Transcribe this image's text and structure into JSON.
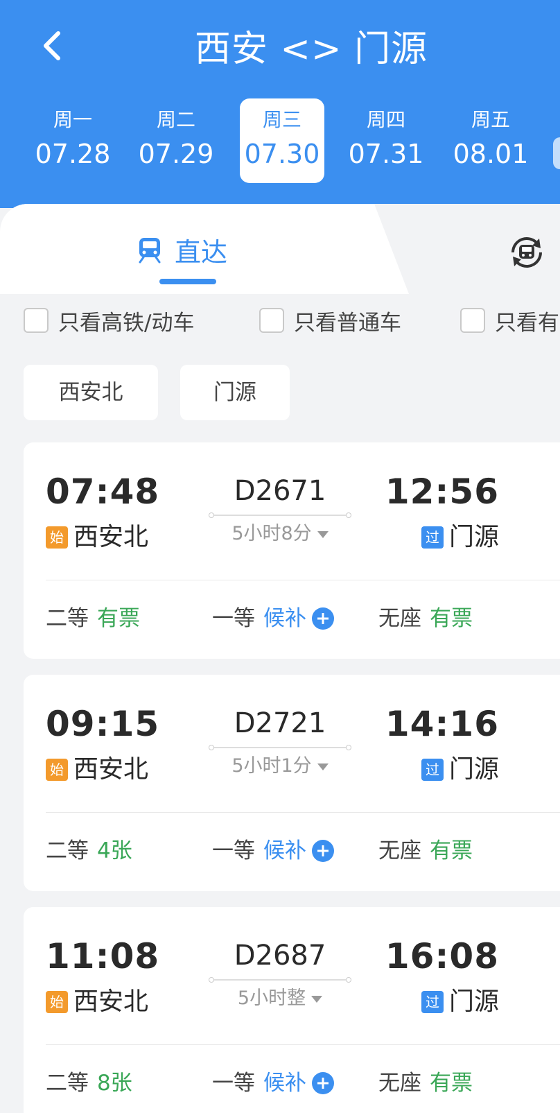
{
  "header": {
    "title": "西安 <> 门源",
    "dates": [
      {
        "weekday": "周一",
        "date": "07.28"
      },
      {
        "weekday": "周二",
        "date": "07.29"
      },
      {
        "weekday": "周三",
        "date": "07.30",
        "selected": true
      },
      {
        "weekday": "周四",
        "date": "07.31"
      },
      {
        "weekday": "周五",
        "date": "08.01"
      }
    ]
  },
  "tabs": {
    "direct_label": "直达",
    "transfer_icon": "transfer-train-icon"
  },
  "filters": [
    {
      "label": "只看高铁/动车",
      "checked": false
    },
    {
      "label": "只看普通车",
      "checked": false
    },
    {
      "label": "只看有",
      "checked": false
    }
  ],
  "stations": [
    "西安北",
    "门源"
  ],
  "trains": [
    {
      "dep_time": "07:48",
      "train_no": "D2671",
      "arr_time": "12:56",
      "dep_tag": "始",
      "dep_station": "西安北",
      "duration": "5小时8分",
      "arr_tag": "过",
      "arr_station": "门源",
      "seats": [
        {
          "name": "二等",
          "status": "有票"
        },
        {
          "name": "一等",
          "status": "候补"
        },
        {
          "name": "无座",
          "status": "有票"
        }
      ]
    },
    {
      "dep_time": "09:15",
      "train_no": "D2721",
      "arr_time": "14:16",
      "dep_tag": "始",
      "dep_station": "西安北",
      "duration": "5小时1分",
      "arr_tag": "过",
      "arr_station": "门源",
      "seats": [
        {
          "name": "二等",
          "status": "4张"
        },
        {
          "name": "一等",
          "status": "候补"
        },
        {
          "name": "无座",
          "status": "有票"
        }
      ]
    },
    {
      "dep_time": "11:08",
      "train_no": "D2687",
      "arr_time": "16:08",
      "dep_tag": "始",
      "dep_station": "西安北",
      "duration": "5小时整",
      "arr_tag": "过",
      "arr_station": "门源",
      "seats": [
        {
          "name": "二等",
          "status": "8张"
        },
        {
          "name": "一等",
          "status": "候补"
        },
        {
          "name": "无座",
          "status": "有票"
        }
      ]
    }
  ],
  "colors": {
    "brand_blue": "#3b8ff0",
    "available_green": "#3aa757",
    "start_tag_orange": "#f39a2c"
  }
}
